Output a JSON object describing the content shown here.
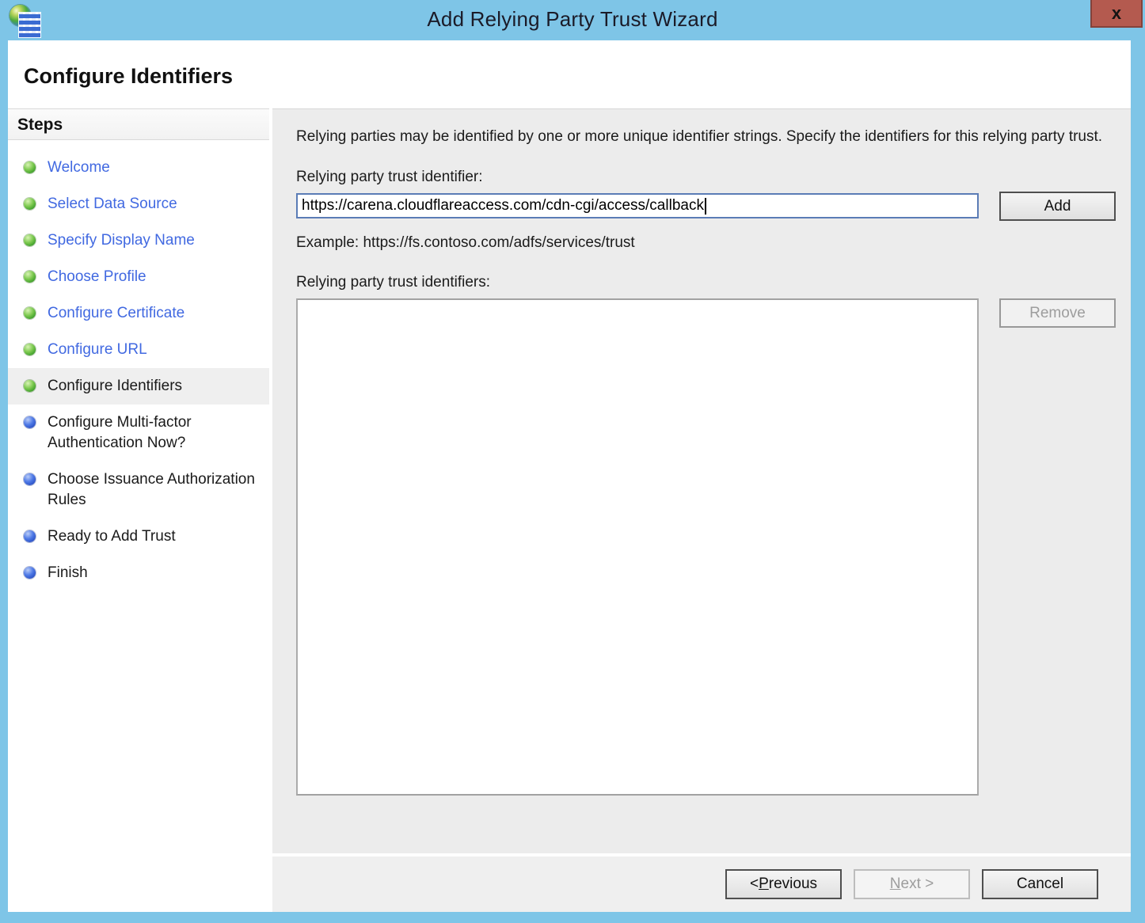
{
  "window": {
    "title": "Add Relying Party Trust Wizard",
    "close_label": "x",
    "page_heading": "Configure Identifiers"
  },
  "steps": {
    "header": "Steps",
    "items": [
      {
        "label": "Welcome",
        "status": "done"
      },
      {
        "label": "Select Data Source",
        "status": "done"
      },
      {
        "label": "Specify Display Name",
        "status": "done"
      },
      {
        "label": "Choose Profile",
        "status": "done"
      },
      {
        "label": "Configure Certificate",
        "status": "done"
      },
      {
        "label": "Configure URL",
        "status": "done"
      },
      {
        "label": "Configure Identifiers",
        "status": "current"
      },
      {
        "label": "Configure Multi-factor Authentication Now?",
        "status": "pending"
      },
      {
        "label": "Choose Issuance Authorization Rules",
        "status": "pending"
      },
      {
        "label": "Ready to Add Trust",
        "status": "pending"
      },
      {
        "label": "Finish",
        "status": "pending"
      }
    ]
  },
  "content": {
    "intro": "Relying parties may be identified by one or more unique identifier strings. Specify the identifiers for this relying party trust.",
    "identifier_label": "Relying party trust identifier:",
    "identifier_value": "https://carena.cloudflareaccess.com/cdn-cgi/access/callback",
    "add_button": "Add",
    "example": "Example: https://fs.contoso.com/adfs/services/trust",
    "identifiers_list_label": "Relying party trust identifiers:",
    "identifiers_list": [],
    "remove_button": "Remove"
  },
  "footer": {
    "previous_prefix": "< ",
    "previous_accel": "P",
    "previous_rest": "revious",
    "next_accel": "N",
    "next_rest": "ext >",
    "cancel_button": "Cancel"
  },
  "colors": {
    "titlebar_blue": "#7EC5E7",
    "close_button_red": "#B45A4F",
    "link_blue": "#4169E1",
    "done_bullet_green": "#43a22e",
    "pending_bullet_blue": "#2a50c4",
    "current_step_highlight": "#efefef",
    "content_background": "#ECECEC",
    "focused_input_border": "#5b7cb6"
  }
}
